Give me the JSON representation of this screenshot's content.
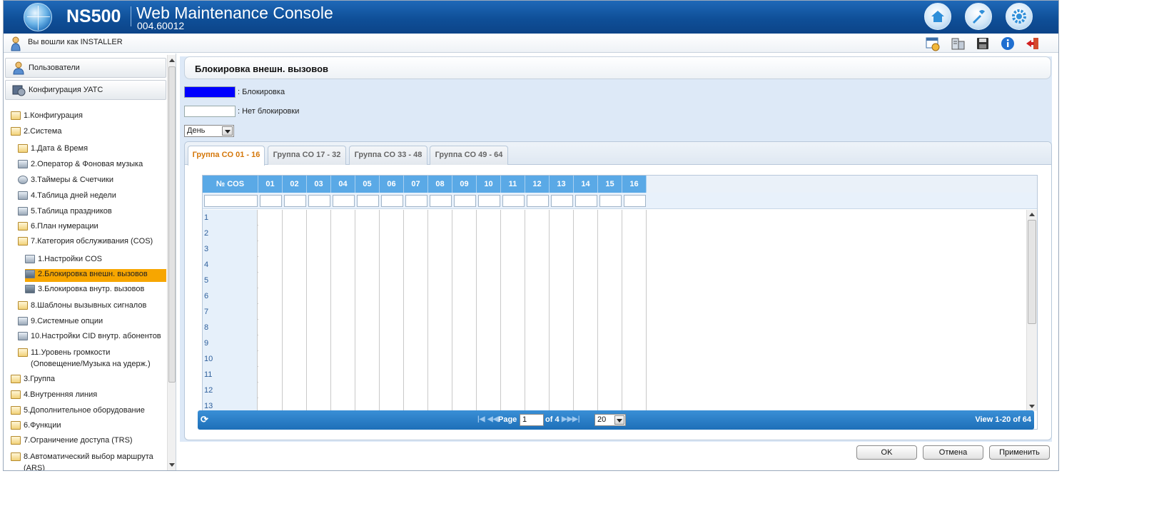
{
  "header": {
    "product": "NS500",
    "title": "Web Maintenance Console",
    "version": "004.60012",
    "buttons": [
      "home-icon",
      "tools-icon",
      "settings-icon"
    ]
  },
  "userbar": {
    "text": "Вы вошли как INSTALLER",
    "tools": [
      "calendar-info-icon",
      "pbx-icon",
      "save-icon",
      "info-icon",
      "logout-icon"
    ]
  },
  "sidebar": {
    "users_label": "Пользователи",
    "pbx_config_label": "Конфигурация УАТС",
    "tree": [
      {
        "label": "1.Конфигурация",
        "level": 0,
        "icon": "folder-icon"
      },
      {
        "label": "2.Система",
        "level": 0,
        "icon": "folder-open-icon"
      },
      {
        "label": "1.Дата & Время",
        "level": 1,
        "icon": "folder-icon"
      },
      {
        "label": "2.Оператор & Фоновая музыка",
        "level": 1,
        "icon": "operator-icon"
      },
      {
        "label": "3.Таймеры & Счетчики",
        "level": 1,
        "icon": "clock-icon"
      },
      {
        "label": "4.Таблица дней недели",
        "level": 1,
        "icon": "table-icon"
      },
      {
        "label": "5.Таблица праздников",
        "level": 1,
        "icon": "calendar-icon"
      },
      {
        "label": "6.План нумерации",
        "level": 1,
        "icon": "folder-icon"
      },
      {
        "label": "7.Категория обслуживания (COS)",
        "level": 1,
        "icon": "folder-open-icon"
      },
      {
        "label": "1.Настройки COS",
        "level": 2,
        "icon": "settings-doc-icon"
      },
      {
        "label": "2.Блокировка внешн. вызовов",
        "level": 2,
        "icon": "block-icon",
        "selected": true
      },
      {
        "label": "3.Блокировка внутр. вызовов",
        "level": 2,
        "icon": "block-icon"
      },
      {
        "label": "8.Шаблоны вызывных сигналов",
        "level": 1,
        "icon": "folder-icon"
      },
      {
        "label": "9.Системные опции",
        "level": 1,
        "icon": "options-icon"
      },
      {
        "label": "10.Настройки CID внутр. абонентов",
        "level": 1,
        "icon": "cid-icon"
      },
      {
        "label": "11.Уровень громкости",
        "label2": "(Оповещение/Музыка на удерж.)",
        "level": 1,
        "icon": "folder-icon"
      },
      {
        "label": "3.Группа",
        "level": 0,
        "icon": "folder-icon"
      },
      {
        "label": "4.Внутренняя линия",
        "level": 0,
        "icon": "folder-icon"
      },
      {
        "label": "5.Дополнительное оборудование",
        "level": 0,
        "icon": "folder-icon"
      },
      {
        "label": "6.Функции",
        "level": 0,
        "icon": "folder-icon"
      },
      {
        "label": "7.Ограничение доступа (TRS)",
        "level": 0,
        "icon": "folder-icon"
      },
      {
        "label": "8.Автоматический выбор маршрута",
        "label2": "(ARS)",
        "level": 0,
        "icon": "folder-icon"
      }
    ]
  },
  "main": {
    "page_title": "Блокировка внешн. вызовов",
    "legend": {
      "blocked_label": ": Блокировка",
      "blocked_color": "#0000ff",
      "unblocked_label": ": Нет блокировки",
      "unblocked_color": "#ffffff"
    },
    "mode_select": "День",
    "tabs": [
      "Группа CO 01 - 16",
      "Группа CO 17 - 32",
      "Группа CO 33 - 48",
      "Группа CO 49 - 64"
    ],
    "active_tab": 0,
    "grid": {
      "columns": [
        "№ COS",
        "01",
        "02",
        "03",
        "04",
        "05",
        "06",
        "07",
        "08",
        "09",
        "10",
        "11",
        "12",
        "13",
        "14",
        "15",
        "16"
      ],
      "rows": [
        "1",
        "2",
        "3",
        "4",
        "5",
        "6",
        "7",
        "8",
        "9",
        "10",
        "11",
        "12",
        "13"
      ]
    },
    "pager": {
      "page_label": "Page",
      "page_value": "1",
      "of_label": "of 4",
      "page_size": "20",
      "view_text": "View 1-20 of 64"
    },
    "buttons": {
      "ok": "OK",
      "cancel": "Отмена",
      "apply": "Применить"
    }
  }
}
